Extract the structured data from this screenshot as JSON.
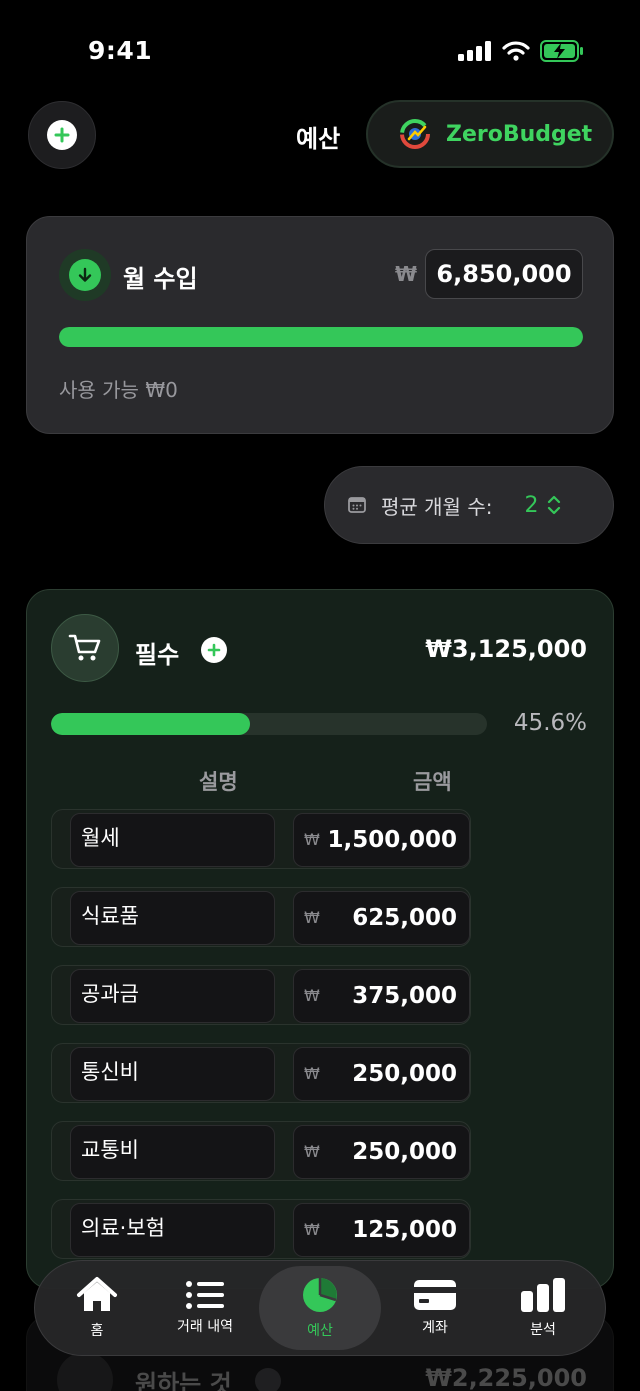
{
  "status": {
    "time": "9:41"
  },
  "header": {
    "title": "예산",
    "brand": "ZeroBudget"
  },
  "income": {
    "label": "월 수입",
    "currency": "₩",
    "amount": "6,850,000",
    "progress_fraction": 1.0,
    "available": "사용 가능 ₩0"
  },
  "avg_months": {
    "label": "평균 개월 수:",
    "value": "2"
  },
  "category": {
    "name": "필수",
    "total": "₩3,125,000",
    "percent_text": "45.6%",
    "progress_fraction": 0.456,
    "col_desc": "설명",
    "col_amount": "금액",
    "currency": "₩",
    "items": [
      {
        "desc": "월세",
        "amount": "1,500,000"
      },
      {
        "desc": "식료품",
        "amount": "625,000"
      },
      {
        "desc": "공과금",
        "amount": "375,000"
      },
      {
        "desc": "통신비",
        "amount": "250,000"
      },
      {
        "desc": "교통비",
        "amount": "250,000"
      },
      {
        "desc": "의료·보험",
        "amount": "125,000"
      }
    ]
  },
  "next_category": {
    "name": "원하는 것",
    "total": "₩2,225,000"
  },
  "tabs": [
    {
      "label": "홈",
      "icon": "house-icon"
    },
    {
      "label": "거래 내역",
      "icon": "list-icon"
    },
    {
      "label": "예산",
      "icon": "pie-chart-icon"
    },
    {
      "label": "계좌",
      "icon": "credit-card-icon"
    },
    {
      "label": "분석",
      "icon": "bar-chart-icon"
    }
  ],
  "colors": {
    "accent": "#34c759",
    "background": "#000000",
    "card": "#2a2a2d"
  }
}
